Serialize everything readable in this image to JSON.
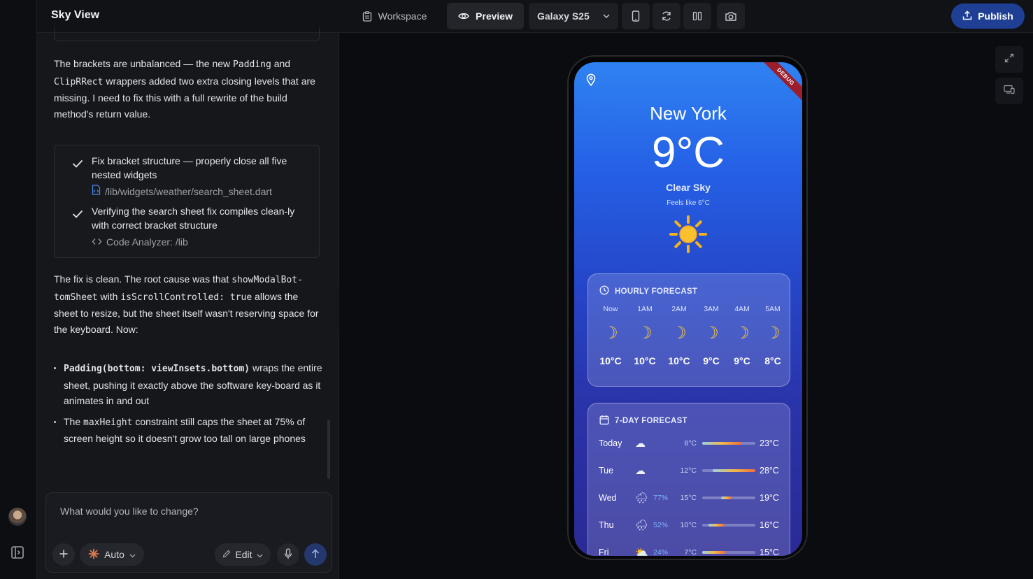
{
  "app": {
    "title": "Sky View"
  },
  "toolbar": {
    "workspace_label": "Workspace",
    "preview_label": "Preview",
    "device_label": "Galaxy S25",
    "publish_label": "Publish"
  },
  "chat": {
    "para1_a": "The brackets are unbalanced — the new ",
    "para1_code1": "Padding",
    "para1_b": " and",
    "para1_code2": "ClipRRect",
    "para1_c": " wrappers added two extra closing levels that are missing. I need to fix this with a full rewrite of the build method's return value.",
    "tasks": [
      {
        "text": "Fix bracket structure — properly close all five nested widgets",
        "sub": "/lib/widgets/weather/search_sheet.dart",
        "sub_icon": "file-code-icon"
      },
      {
        "text": "Verifying the search sheet fix compiles clean-ly with correct bracket structure",
        "sub": "Code Analyzer: /lib",
        "sub_icon": "code-brackets-icon"
      }
    ],
    "para2_a": "The fix is clean. The root cause was that ",
    "para2_code1": "showModalBot-tomSheet",
    "para2_b": " with ",
    "para2_code2": "isScrollControlled: true",
    "para2_c": " allows the sheet to resize, but the sheet itself wasn't reserving space for the keyboard. Now:",
    "bullet1_code": "Padding(bottom: viewInsets.bottom)",
    "bullet1_text": " wraps the entire sheet, pushing it exactly above the software key-board as it animates in and out",
    "bullet2_a": "The ",
    "bullet2_code": "maxHeight",
    "bullet2_b": " constraint still caps the sheet at 75% of screen height so it doesn't grow too tall on large phones"
  },
  "composer": {
    "placeholder": "What would you like to change?",
    "auto_label": "Auto",
    "edit_label": "Edit"
  },
  "weather": {
    "debug_banner": "DEBUG",
    "city": "New York",
    "temperature": "9°C",
    "condition": "Clear Sky",
    "feels_like": "Feels like 6°C",
    "hourly_title": "HOURLY FORECAST",
    "hourly": [
      {
        "hour": "Now",
        "temp": "10°C"
      },
      {
        "hour": "1AM",
        "temp": "10°C"
      },
      {
        "hour": "2AM",
        "temp": "10°C"
      },
      {
        "hour": "3AM",
        "temp": "9°C"
      },
      {
        "hour": "4AM",
        "temp": "9°C"
      },
      {
        "hour": "5AM",
        "temp": "8°C"
      }
    ],
    "weekly_title": "7-DAY FORECAST",
    "weekly": [
      {
        "day": "Today",
        "icon": "cloud-icon",
        "pct": "",
        "lo": "8°C",
        "hi": "23°C",
        "range_start": 0.0,
        "range_end": 0.75
      },
      {
        "day": "Tue",
        "icon": "cloud-icon",
        "pct": "",
        "lo": "12°C",
        "hi": "28°C",
        "range_start": 0.2,
        "range_end": 1.0
      },
      {
        "day": "Wed",
        "icon": "rain-cloud-icon",
        "pct": "77%",
        "lo": "15°C",
        "hi": "19°C",
        "range_start": 0.35,
        "range_end": 0.55
      },
      {
        "day": "Thu",
        "icon": "rain-cloud-icon",
        "pct": "52%",
        "lo": "10°C",
        "hi": "16°C",
        "range_start": 0.12,
        "range_end": 0.42
      },
      {
        "day": "Fri",
        "icon": "sun-behind-cloud-icon",
        "pct": "24%",
        "lo": "7°C",
        "hi": "15°C",
        "range_start": 0.0,
        "range_end": 0.45
      }
    ]
  }
}
